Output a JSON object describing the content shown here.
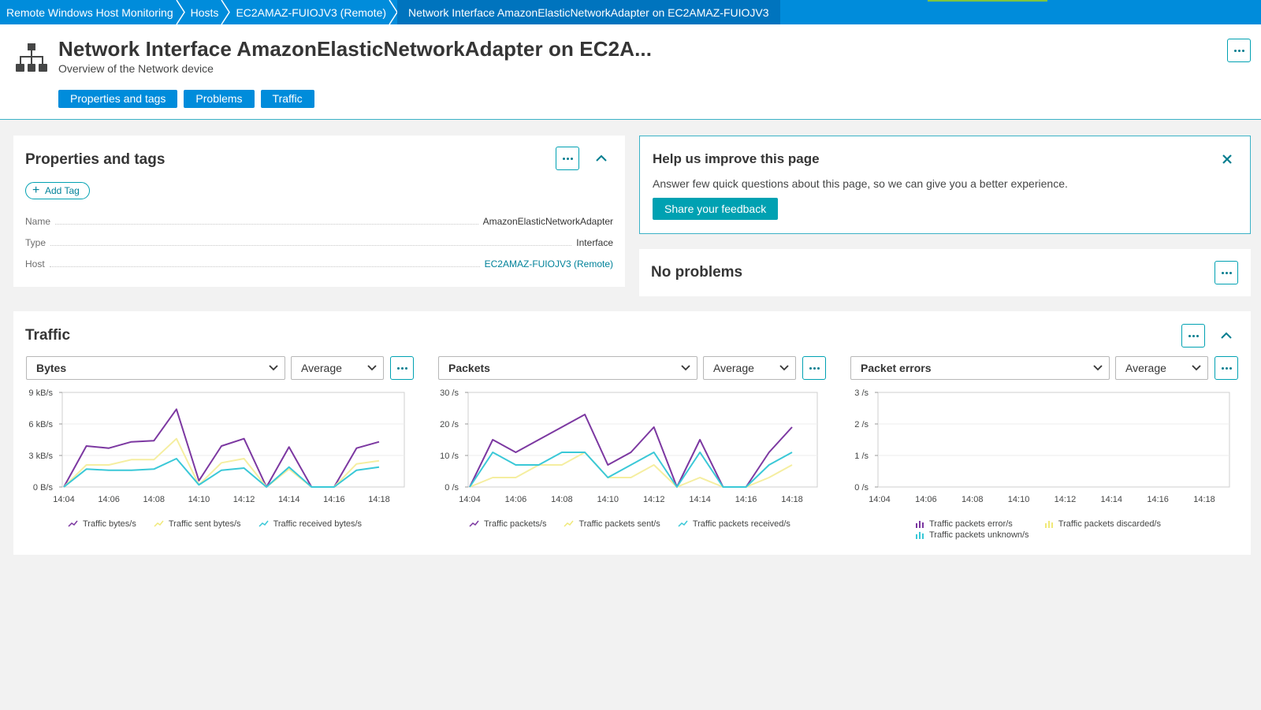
{
  "breadcrumb": [
    {
      "label": "Remote Windows Host Monitoring"
    },
    {
      "label": "Hosts"
    },
    {
      "label": "EC2AMAZ-FUIOJV3 (Remote)"
    },
    {
      "label": "Network Interface AmazonElasticNetworkAdapter on EC2AMAZ-FUIOJV3"
    }
  ],
  "header": {
    "title": "Network Interface AmazonElasticNetworkAdapter on EC2A...",
    "subtitle": "Overview of the Network device",
    "icon": "network-topology-icon",
    "jump_buttons": [
      "Properties and tags",
      "Problems",
      "Traffic"
    ]
  },
  "properties": {
    "title": "Properties and tags",
    "add_tag": "Add Tag",
    "rows": [
      {
        "key": "Name",
        "value": "AmazonElasticNetworkAdapter"
      },
      {
        "key": "Type",
        "value": "Interface"
      },
      {
        "key": "Host",
        "value": "EC2AMAZ-FUIOJV3 (Remote)"
      }
    ]
  },
  "feedback": {
    "title": "Help us improve this page",
    "text": "Answer few quick questions about this page, so we can give you a better experience.",
    "button": "Share your feedback"
  },
  "problems": {
    "title": "No problems"
  },
  "traffic": {
    "title": "Traffic",
    "panels": [
      {
        "metric": "Bytes",
        "aggregation": "Average"
      },
      {
        "metric": "Packets",
        "aggregation": "Average"
      },
      {
        "metric": "Packet errors",
        "aggregation": "Average"
      }
    ]
  },
  "colors": {
    "purple": "#7c38a1",
    "yellow": "#f5f3a1",
    "cyan": "#3ac8d7",
    "light_blue": "#7dd3e3",
    "accent": "#008cdb",
    "teal": "#00a1b2"
  },
  "chart_data": [
    {
      "type": "line",
      "x": [
        "14:04",
        "14:05",
        "14:06",
        "14:07",
        "14:08",
        "14:09",
        "14:10",
        "14:11",
        "14:12",
        "14:13",
        "14:14",
        "14:15",
        "14:16",
        "14:17",
        "14:18"
      ],
      "xticks": [
        "14:04",
        "14:06",
        "14:08",
        "14:10",
        "14:12",
        "14:14",
        "14:16",
        "14:18"
      ],
      "yticks": [
        "9 kB/s",
        "6 kB/s",
        "3 kB/s",
        "0 B/s"
      ],
      "ylim": [
        0,
        9
      ],
      "series": [
        {
          "name": "Traffic bytes/s",
          "color": "#7c38a1",
          "values": [
            0,
            3.9,
            3.7,
            4.3,
            4.4,
            7.4,
            0.6,
            3.9,
            4.6,
            0,
            3.8,
            0,
            0,
            3.7,
            4.3
          ]
        },
        {
          "name": "Traffic sent bytes/s",
          "color": "#f5f3a1",
          "values": [
            0,
            2.1,
            2.1,
            2.6,
            2.6,
            4.6,
            0.2,
            2.3,
            2.7,
            0,
            1.7,
            0,
            0,
            2.2,
            2.5
          ]
        },
        {
          "name": "Traffic received bytes/s",
          "color": "#3ac8d7",
          "values": [
            0,
            1.7,
            1.6,
            1.6,
            1.7,
            2.7,
            0.2,
            1.6,
            1.8,
            0,
            1.9,
            0,
            0,
            1.6,
            1.9
          ]
        }
      ]
    },
    {
      "type": "line",
      "x": [
        "14:04",
        "14:05",
        "14:06",
        "14:07",
        "14:08",
        "14:09",
        "14:10",
        "14:11",
        "14:12",
        "14:13",
        "14:14",
        "14:15",
        "14:16",
        "14:17",
        "14:18"
      ],
      "xticks": [
        "14:04",
        "14:06",
        "14:08",
        "14:10",
        "14:12",
        "14:14",
        "14:16",
        "14:18"
      ],
      "yticks": [
        "30 /s",
        "20 /s",
        "10 /s",
        "0 /s"
      ],
      "ylim": [
        0,
        30
      ],
      "series": [
        {
          "name": "Traffic packets/s",
          "color": "#7c38a1",
          "values": [
            0,
            15,
            11,
            15,
            19,
            23,
            7,
            11,
            19,
            0,
            15,
            0,
            0,
            11,
            19
          ]
        },
        {
          "name": "Traffic packets sent/s",
          "color": "#f5f3a1",
          "values": [
            0,
            3,
            3,
            7,
            7,
            11,
            3,
            3,
            7,
            0,
            3,
            0,
            0,
            3,
            7
          ]
        },
        {
          "name": "Traffic packets received/s",
          "color": "#3ac8d7",
          "values": [
            0,
            11,
            7,
            7,
            11,
            11,
            3,
            7,
            11,
            0,
            11,
            0,
            0,
            7,
            11
          ]
        }
      ]
    },
    {
      "type": "bar",
      "x": [
        "14:04",
        "14:05",
        "14:06",
        "14:07",
        "14:08",
        "14:09",
        "14:10",
        "14:11",
        "14:12",
        "14:13",
        "14:14",
        "14:15",
        "14:16",
        "14:17",
        "14:18"
      ],
      "xticks": [
        "14:04",
        "14:06",
        "14:08",
        "14:10",
        "14:12",
        "14:14",
        "14:16",
        "14:18"
      ],
      "yticks": [
        "3 /s",
        "2 /s",
        "1 /s",
        "0 /s"
      ],
      "ylim": [
        0,
        3
      ],
      "series": [
        {
          "name": "Traffic packets error/s",
          "color": "#7c38a1",
          "values": []
        },
        {
          "name": "Traffic packets discarded/s",
          "color": "#f5f3a1",
          "values": []
        },
        {
          "name": "Traffic packets unknown/s",
          "color": "#3ac8d7",
          "values": []
        }
      ]
    }
  ]
}
